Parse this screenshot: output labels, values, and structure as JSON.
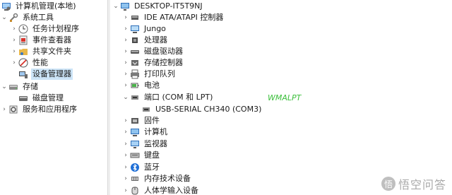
{
  "left_tree": {
    "root": "计算机管理(本地)",
    "system_tools": "系统工具",
    "task_scheduler": "任务计划程序",
    "event_viewer": "事件查看器",
    "shared_folders": "共享文件夹",
    "performance": "性能",
    "device_manager": "设备管理器",
    "storage": "存储",
    "disk_management": "磁盘管理",
    "services_apps": "服务和应用程序"
  },
  "device_tree": {
    "computer": "DESKTOP-IT5T9NJ",
    "categories": [
      {
        "label": "IDE ATA/ATAPI 控制器",
        "icon": "ide-controller-icon"
      },
      {
        "label": "Jungo",
        "icon": "jungo-icon"
      },
      {
        "label": "处理器",
        "icon": "processor-icon"
      },
      {
        "label": "磁盘驱动器",
        "icon": "disk-drive-icon"
      },
      {
        "label": "存储控制器",
        "icon": "storage-controller-icon"
      },
      {
        "label": "打印队列",
        "icon": "print-queue-icon"
      },
      {
        "label": "电池",
        "icon": "battery-icon"
      },
      {
        "label": "端口 (COM 和 LPT)",
        "icon": "port-icon",
        "expanded": true
      },
      {
        "label": "固件",
        "icon": "firmware-icon"
      },
      {
        "label": "计算机",
        "icon": "computer-icon"
      },
      {
        "label": "监视器",
        "icon": "monitor-icon"
      },
      {
        "label": "键盘",
        "icon": "keyboard-icon"
      },
      {
        "label": "蓝牙",
        "icon": "bluetooth-icon"
      },
      {
        "label": "内存技术设备",
        "icon": "memory-tech-icon"
      },
      {
        "label": "人体学输入设备",
        "icon": "hid-icon"
      }
    ],
    "port_child": "USB-SERIAL CH340 (COM3)"
  },
  "overlay_annotation": "WMALPT",
  "watermark": {
    "text": "悟空问答",
    "logo_char": "悟"
  }
}
